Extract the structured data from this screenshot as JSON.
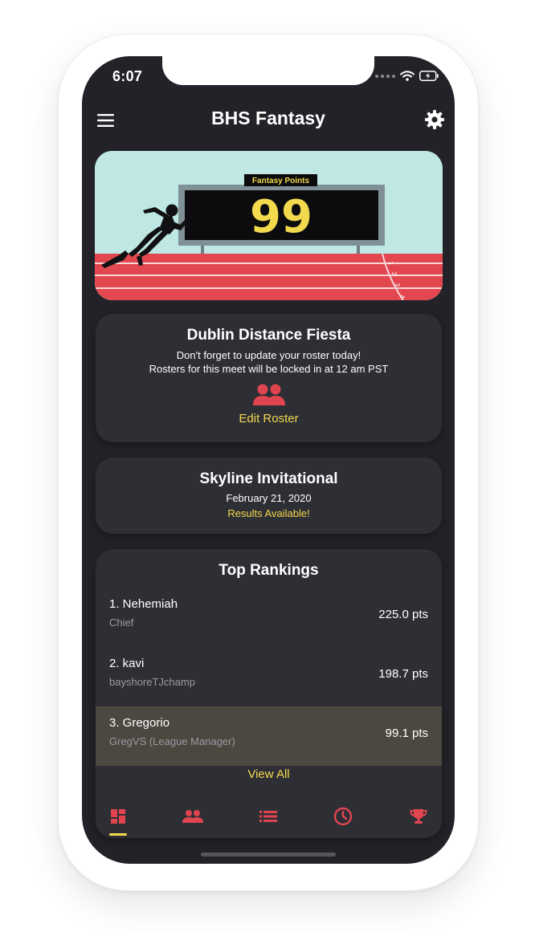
{
  "status_bar": {
    "time": "6:07"
  },
  "header": {
    "title": "BHS Fantasy"
  },
  "hero": {
    "scoreboard_label": "Fantasy Points",
    "points": "99",
    "lane_numbers": [
      "1",
      "2",
      "3",
      "4"
    ]
  },
  "upcoming_meet": {
    "title": "Dublin Distance Fiesta",
    "line1": "Don't forget to update your roster today!",
    "line2": "Rosters for this meet will be locked in at 12 am PST",
    "action_label": "Edit Roster"
  },
  "past_meet": {
    "title": "Skyline Invitational",
    "date": "February 21, 2020",
    "status": "Results Available!"
  },
  "rankings": {
    "title": "Top Rankings",
    "rows": [
      {
        "name": "1. Nehemiah",
        "sub": "Chief",
        "points": "225.0 pts"
      },
      {
        "name": "2. kavi",
        "sub": "bayshoreTJchamp",
        "points": "198.7 pts"
      },
      {
        "name": "3. Gregorio",
        "sub": "GregVS (League Manager)",
        "points": "99.1 pts"
      }
    ],
    "view_all_label": "View All"
  },
  "tabs": [
    {
      "icon": "dashboard-icon",
      "active": true
    },
    {
      "icon": "team-icon",
      "active": false
    },
    {
      "icon": "list-icon",
      "active": false
    },
    {
      "icon": "clock-icon",
      "active": false
    },
    {
      "icon": "trophy-icon",
      "active": false
    }
  ],
  "colors": {
    "background": "#222228",
    "card": "#2e2e35",
    "accent_yellow": "#f2d94e",
    "accent_red": "#e0454f",
    "highlight_row": "#4b4840"
  }
}
